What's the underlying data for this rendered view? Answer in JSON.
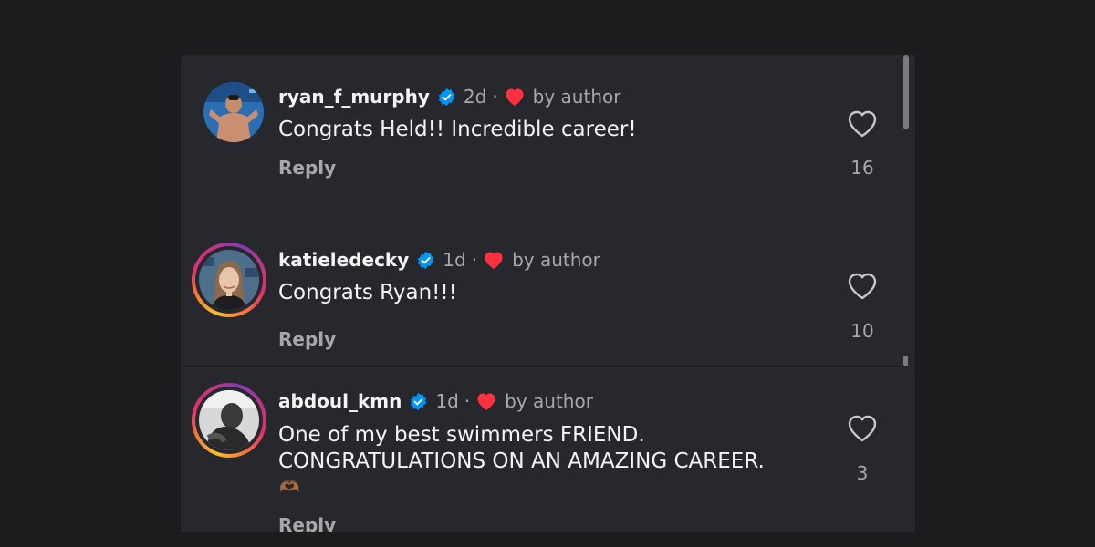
{
  "comments": [
    {
      "username": "ryan_f_murphy",
      "age": "2d",
      "separator": "·",
      "author_tag": "by author",
      "text_lines": [
        "Congrats Held!! Incredible career!"
      ],
      "reply_label": "Reply",
      "like_count": "16",
      "has_story_ring": false
    },
    {
      "username": "katieledecky",
      "age": "1d",
      "separator": "·",
      "author_tag": "by author",
      "text_lines": [
        "Congrats Ryan!!!"
      ],
      "reply_label": "Reply",
      "like_count": "10",
      "has_story_ring": true
    },
    {
      "username": "abdoul_kmn",
      "age": "1d",
      "separator": "·",
      "author_tag": "by author",
      "text_lines": [
        "One of my best swimmers FRIEND.",
        "CONGRATULATIONS ON AN AMAZING CAREER."
      ],
      "emoji": "🫶🏾",
      "reply_label": "Reply",
      "like_count": "3",
      "has_story_ring": true
    }
  ],
  "icons": {
    "verified": "verified-badge-icon",
    "author_heart": "heart-filled-icon",
    "like": "heart-outline-icon"
  },
  "colors": {
    "background": "#1b1c1e",
    "panel": "#26282d",
    "verified": "#0095f6",
    "author_heart": "#ff3040",
    "muted_text": "#a8a8a8"
  }
}
